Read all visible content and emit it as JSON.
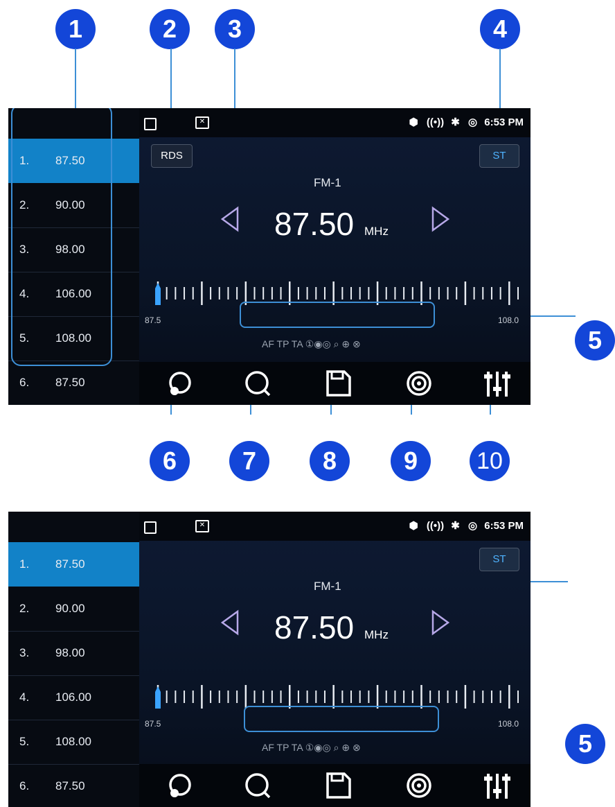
{
  "callouts": [
    "1",
    "2",
    "3",
    "4",
    "5",
    "6",
    "7",
    "8",
    "9",
    "10"
  ],
  "status": {
    "time": "6:53 PM"
  },
  "presets": [
    {
      "num": "1.",
      "freq": "87.50"
    },
    {
      "num": "2.",
      "freq": "90.00"
    },
    {
      "num": "3.",
      "freq": "98.00"
    },
    {
      "num": "4.",
      "freq": "106.00"
    },
    {
      "num": "5.",
      "freq": "108.00"
    },
    {
      "num": "6.",
      "freq": "87.50"
    }
  ],
  "radio": {
    "rds_label": "RDS",
    "st_label": "ST",
    "band": "FM-1",
    "frequency": "87.50",
    "unit": "MHz",
    "scale_min": "87.5",
    "scale_max": "108.0",
    "rds_flags": "AF TP TA"
  },
  "toolbar": {
    "icons": [
      "cycle-icon",
      "search-icon",
      "save-icon",
      "broadcast-icon",
      "equalizer-icon"
    ]
  },
  "colors": {
    "accent": "#1282c8",
    "callout": "#1346d8",
    "st_text": "#4fb3ff"
  }
}
